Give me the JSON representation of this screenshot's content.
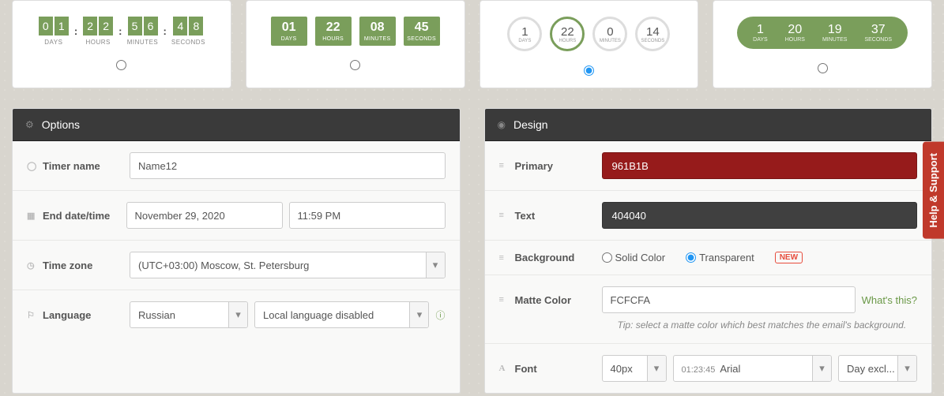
{
  "previews": {
    "s1": {
      "digits": [
        "0",
        "1",
        "2",
        "2",
        "5",
        "6",
        "4",
        "8"
      ],
      "labels": [
        "DAYS",
        "HOURS",
        "MINUTES",
        "SECONDS"
      ]
    },
    "s2": [
      {
        "num": "01",
        "lbl": "DAYS"
      },
      {
        "num": "22",
        "lbl": "HOURS"
      },
      {
        "num": "08",
        "lbl": "MINUTES"
      },
      {
        "num": "45",
        "lbl": "SECONDS"
      }
    ],
    "s3": [
      {
        "num": "1",
        "lbl": "DAYS"
      },
      {
        "num": "22",
        "lbl": "HOURS"
      },
      {
        "num": "0",
        "lbl": "MINUTES"
      },
      {
        "num": "14",
        "lbl": "SECONDS"
      }
    ],
    "s4": [
      {
        "num": "1",
        "lbl": "DAYS"
      },
      {
        "num": "20",
        "lbl": "HOURS"
      },
      {
        "num": "19",
        "lbl": "MINUTES"
      },
      {
        "num": "37",
        "lbl": "SECONDS"
      }
    ]
  },
  "options": {
    "header": "Options",
    "timer_name_label": "Timer name",
    "timer_name_value": "Name12",
    "end_datetime_label": "End date/time",
    "end_date_value": "November 29, 2020",
    "end_time_value": "11:59 PM",
    "timezone_label": "Time zone",
    "timezone_value": "(UTC+03:00) Moscow, St. Petersburg",
    "language_label": "Language",
    "language_value": "Russian",
    "local_lang_value": "Local language disabled"
  },
  "design": {
    "header": "Design",
    "primary_label": "Primary",
    "primary_value": "961B1B",
    "primary_hex": "#961B1B",
    "text_label": "Text",
    "text_value": "404040",
    "text_hex": "#404040",
    "background_label": "Background",
    "bg_solid": "Solid Color",
    "bg_trans": "Transparent",
    "new_badge": "NEW",
    "matte_label": "Matte Color",
    "matte_value": "FCFCFA",
    "whats_this": "What's this?",
    "tip": "Tip: select a matte color which best matches the email's background.",
    "font_label": "Font",
    "font_size": "40px",
    "font_sample": "01:23:45",
    "font_family": "Arial",
    "day_excl": "Day excl..."
  },
  "help": "Help & Support"
}
